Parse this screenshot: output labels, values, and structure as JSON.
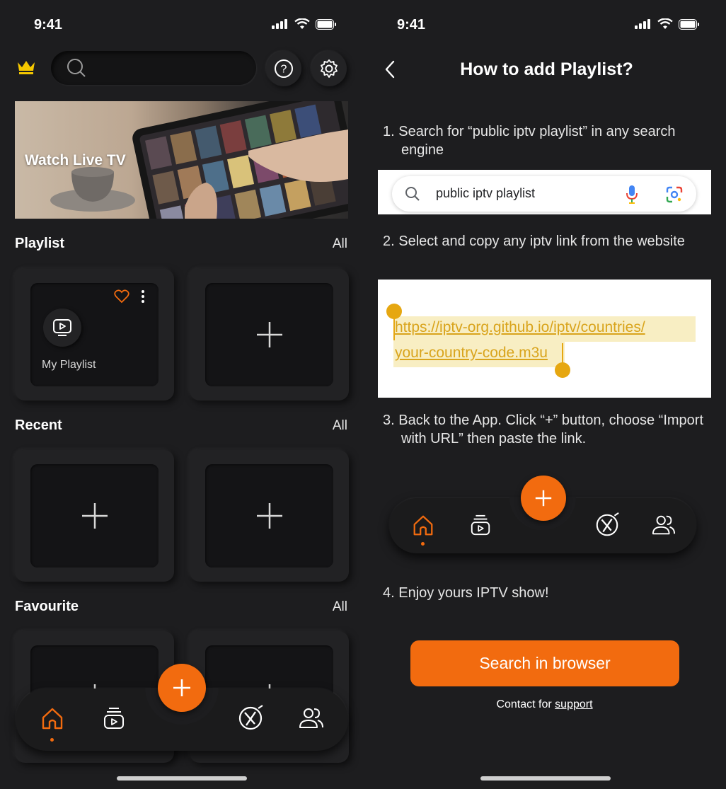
{
  "left_screen": {
    "status": {
      "time": "9:41"
    },
    "search": {
      "placeholder": ""
    },
    "banner": {
      "title": "Watch Live TV"
    },
    "sections": {
      "playlist": {
        "title": "Playlist",
        "all_label": "All",
        "items": [
          {
            "name": "My Playlist"
          }
        ]
      },
      "recent": {
        "title": "Recent",
        "all_label": "All"
      },
      "favourite": {
        "title": "Favourite",
        "all_label": "All"
      }
    },
    "nav": {
      "items": [
        "home-icon",
        "playlist-icon",
        "no-ads-icon",
        "users-icon"
      ],
      "active": "home-icon"
    }
  },
  "right_screen": {
    "status": {
      "time": "9:41"
    },
    "title": "How to add Playlist?",
    "steps": [
      "1. Search for “public iptv playlist” in any search engine",
      "2. Select and copy any iptv link from the website",
      "3. Back to the App. Click “+” button, choose “Import with URL” then paste the link.",
      "4. Enjoy yours IPTV show!"
    ],
    "example_search_query": "public iptv playlist",
    "example_url_line1": "https://iptv-org.github.io/iptv/countries/",
    "example_url_line2": "your-country-code.m3u",
    "cta_label": "Search in browser",
    "contact_prefix": "Contact for",
    "contact_link": "support"
  },
  "colors": {
    "accent": "#f26b0f",
    "background": "#1d1d1f",
    "crown": "#f5c800",
    "highlight": "#f8eec3"
  }
}
